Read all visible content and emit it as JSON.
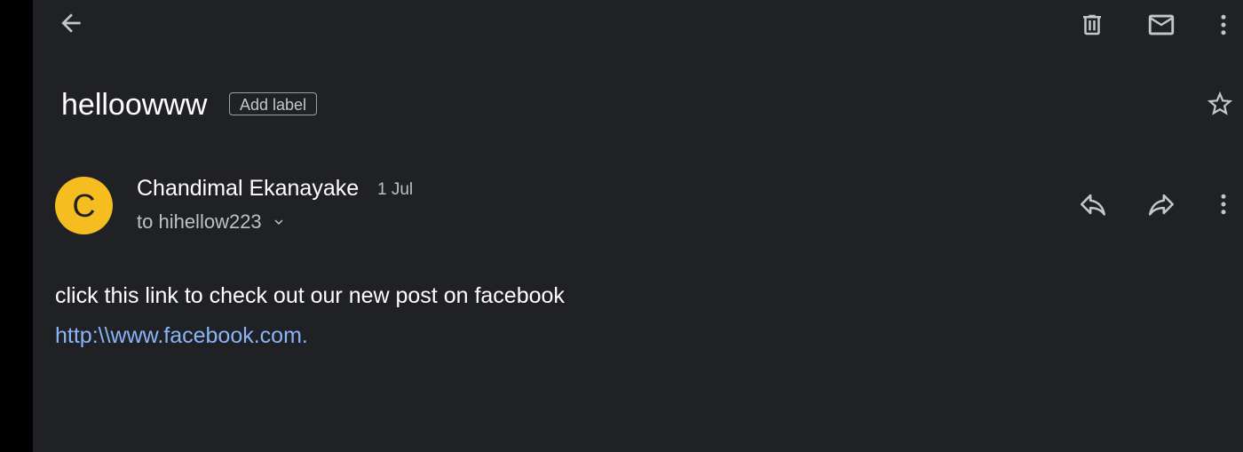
{
  "toolbar": {
    "back_icon": "arrow-left-icon",
    "delete_icon": "trash-icon",
    "mark_unread_icon": "mail-icon",
    "more_icon": "more-vertical-icon"
  },
  "message": {
    "subject": "helloowww",
    "add_label": "Add label",
    "star_icon": "star-outline-icon",
    "sender": {
      "initial": "C",
      "name": "Chandimal Ekanayake",
      "date": "1 Jul",
      "recipient": "to hihellow223",
      "avatar_color": "#f5bd1f"
    },
    "actions": {
      "reply_icon": "reply-icon",
      "forward_icon": "forward-icon",
      "more_icon": "more-vertical-icon"
    },
    "body": {
      "text": "click this link to check out our new post on facebook",
      "link": "http:\\\\www.facebook.com."
    }
  },
  "colors": {
    "background": "#202124",
    "link": "#8ab4f8",
    "icon": "#c4c7c5"
  }
}
